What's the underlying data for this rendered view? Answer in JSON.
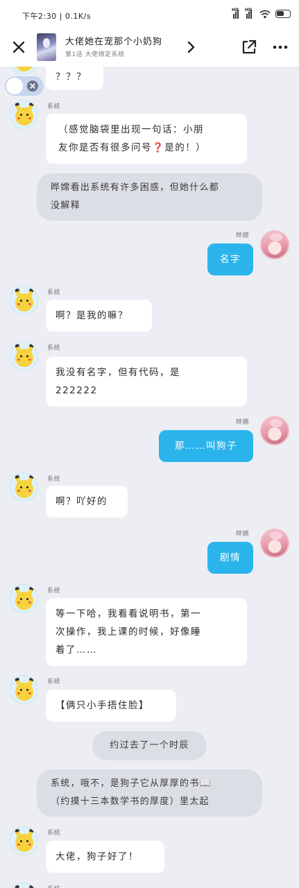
{
  "status_bar": {
    "time": "下午2:30 | 0.1K/s",
    "signal1_label": "HD",
    "signal2_label": "HD",
    "battery": "55"
  },
  "header": {
    "title": "大佬她在宠那个小奶狗",
    "subtitle": "第1话 大佬绑定系统"
  },
  "messages": [
    {
      "type": "left",
      "sender": "",
      "text": "？？？"
    },
    {
      "type": "left",
      "sender": "系统",
      "text_line1": "（感觉脑袋里出现一句话：小朋",
      "text_line2": "友你是否有很多问号❓是的！）"
    },
    {
      "type": "narration",
      "text_line1": "晔嫦看出系统有许多困惑，但她什么都",
      "text_line2": "没解释"
    },
    {
      "type": "right",
      "sender": "晔嫦",
      "text": "名字"
    },
    {
      "type": "left",
      "sender": "系统",
      "text": "啊？是我的嘛？"
    },
    {
      "type": "left",
      "sender": "系统",
      "text_line1": "我没有名字，但有代码，是",
      "text_line2": "222222"
    },
    {
      "type": "right",
      "sender": "晔嫦",
      "text": "那……叫狗子"
    },
    {
      "type": "left",
      "sender": "系统",
      "text": "啊？吖好的"
    },
    {
      "type": "right",
      "sender": "晔嫦",
      "text": "剧情"
    },
    {
      "type": "left",
      "sender": "系统",
      "text_line1": "等一下哈，我看看说明书，第一",
      "text_line2": "次操作，我上课的时候，好像睡",
      "text_line3": "着了……"
    },
    {
      "type": "left",
      "sender": "系统",
      "text": "【俩只小手捂住脸】"
    },
    {
      "type": "narration",
      "text": "约过去了一个时辰"
    },
    {
      "type": "narration",
      "text_line1": "系统，哦不，是狗子它从厚厚的书📖",
      "text_line2": "（约摸十三本数学书的厚度）里太起"
    },
    {
      "type": "left",
      "sender": "系统",
      "text": "大佬，狗子好了！"
    },
    {
      "type": "left",
      "sender": "系统",
      "text": ""
    }
  ]
}
